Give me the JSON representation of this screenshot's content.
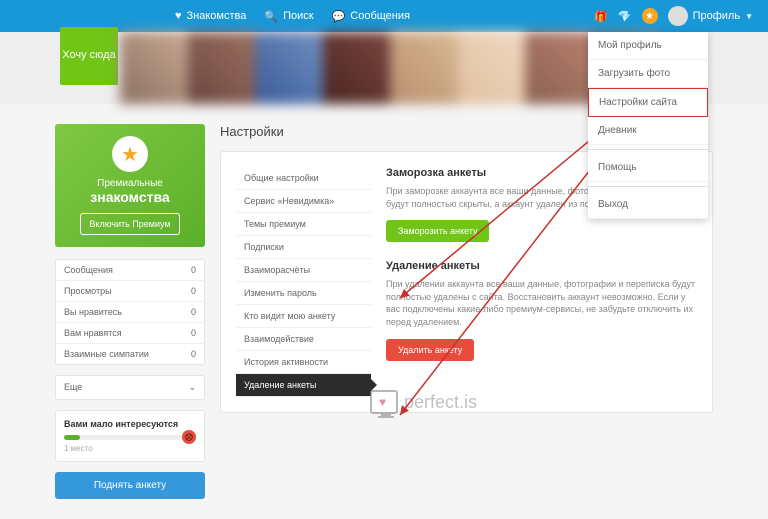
{
  "nav": {
    "dating": "Знакомства",
    "search": "Поиск",
    "messages": "Сообщения",
    "profile": "Профиль"
  },
  "want_here": "Хочу сюда",
  "dropdown": [
    "Мой профиль",
    "Загрузить фото",
    "Настройки сайта",
    "Дневник",
    "Помощь",
    "Выход"
  ],
  "premium": {
    "line1": "Премиальные",
    "line2": "знакомства",
    "btn": "Включить Премиум"
  },
  "stats": [
    [
      "Сообщения",
      "0"
    ],
    [
      "Просмотры",
      "0"
    ],
    [
      "Вы нравитесь",
      "0"
    ],
    [
      "Вам нравятся",
      "0"
    ],
    [
      "Взаимные симпатии",
      "0"
    ]
  ],
  "more": "Еще",
  "interest": {
    "title": "Вами мало интересуются",
    "place": "1 место"
  },
  "raise": "Поднять анкету",
  "settings_title": "Настройки",
  "snav": [
    "Общие настройки",
    "Сервис «Невидимка»",
    "Темы премиум",
    "Подписки",
    "Взаиморасчёты",
    "Изменить пароль",
    "Кто видит мою анкету",
    "Взаимодействие",
    "История активности",
    "Удаление анкеты"
  ],
  "freeze": {
    "title": "Заморозка анкеты",
    "text": "При заморозке аккаунта все ваши данные, фотографии и переписка будут полностью скрыты, а аккаунт удален из поиска.",
    "btn": "Заморозить анкету"
  },
  "delete": {
    "title": "Удаление анкеты",
    "text": "При удалении аккаунта все ваши данные, фотографии и переписка будут полностью удалены с сайта. Восстановить аккаунт невозможно. Если у вас подключены какие-либо премиум-сервисы, не забудьте отключить их перед удалением.",
    "btn": "Удалить анкету"
  },
  "watermark": "perfect.is"
}
